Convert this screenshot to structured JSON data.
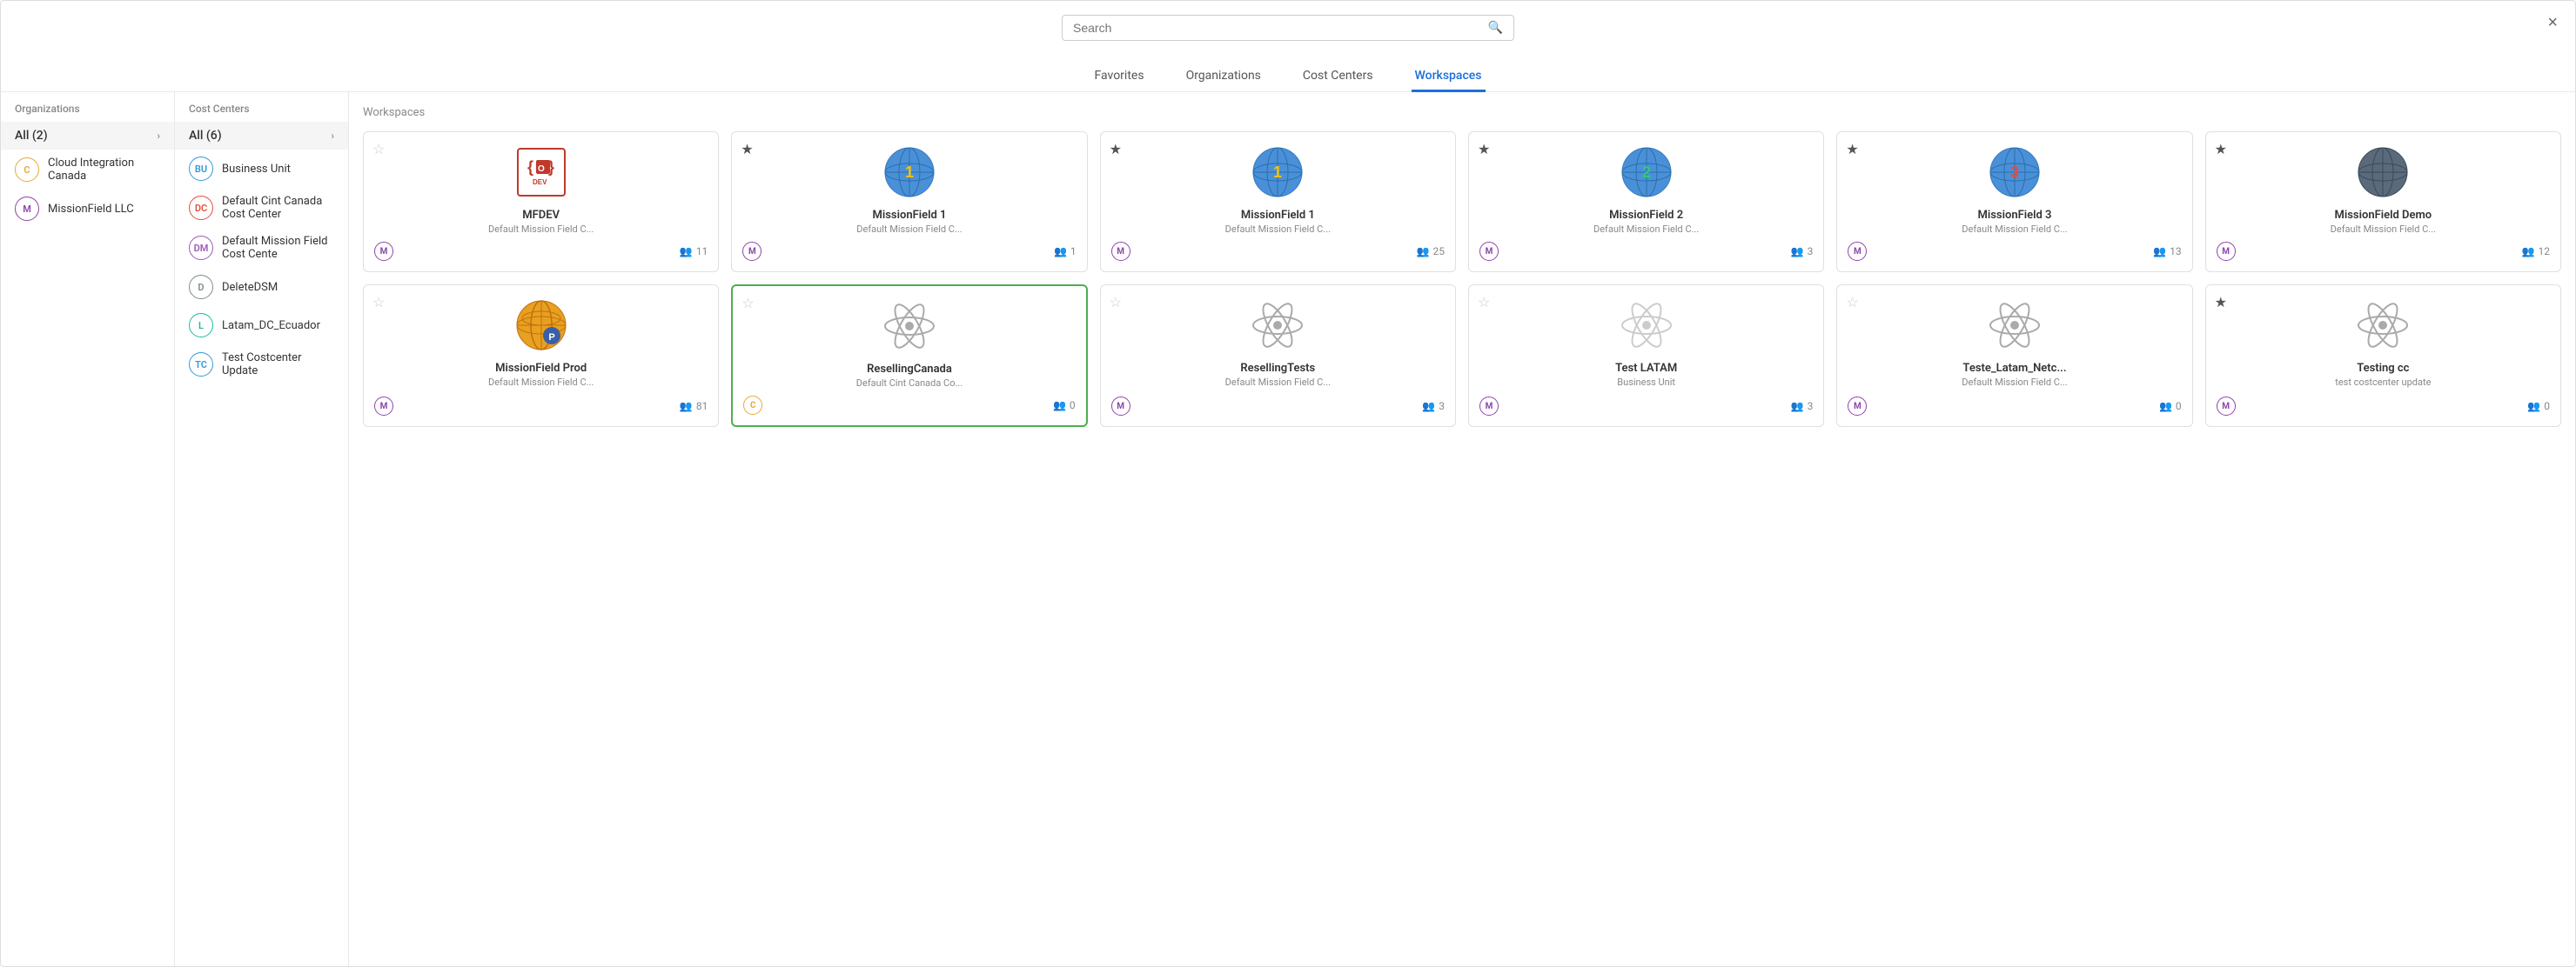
{
  "header": {
    "search_placeholder": "Search",
    "close_label": "×",
    "tabs": [
      {
        "id": "favorites",
        "label": "Favorites",
        "active": false
      },
      {
        "id": "organizations",
        "label": "Organizations",
        "active": false
      },
      {
        "id": "cost-centers",
        "label": "Cost Centers",
        "active": false
      },
      {
        "id": "workspaces",
        "label": "Workspaces",
        "active": true
      }
    ]
  },
  "sidebar": {
    "organizations": {
      "title": "Organizations",
      "all_label": "All (2)",
      "items": [
        {
          "id": "cloud-integration",
          "letter": "C",
          "name": "Cloud Integration Canada",
          "color": "#e8a838"
        },
        {
          "id": "missionfield",
          "letter": "M",
          "name": "MissionField LLC",
          "color": "#8e44ad"
        }
      ]
    },
    "cost_centers": {
      "title": "Cost Centers",
      "all_label": "All (6)",
      "items": [
        {
          "id": "business-unit",
          "letters": "BU",
          "name": "Business Unit",
          "color": "#3498db"
        },
        {
          "id": "default-cint",
          "letters": "DC",
          "name": "Default Cint Canada Cost Center",
          "color": "#e74c3c"
        },
        {
          "id": "default-mission",
          "letters": "DM",
          "name": "Default Mission Field Cost Cente",
          "color": "#9b59b6"
        },
        {
          "id": "delete-dsm",
          "letters": "D",
          "name": "DeleteDSM",
          "color": "#7f8c8d"
        },
        {
          "id": "latam-dc",
          "letters": "L",
          "name": "Latam_DC_Ecuador",
          "color": "#1abc9c"
        },
        {
          "id": "test-costcenter",
          "letters": "TC",
          "name": "Test Costcenter Update",
          "color": "#3498db"
        }
      ]
    }
  },
  "main": {
    "title": "Workspaces",
    "rows": [
      [
        {
          "id": "mfdev",
          "name": "MFDEV",
          "subtitle": "Default Mission Field C...",
          "type": "office",
          "star": false,
          "org_letter": "M",
          "org_color": "#8e44ad",
          "users": 11,
          "selected": false
        },
        {
          "id": "missionfield1-a",
          "name": "MissionField 1",
          "subtitle": "Default Mission Field C...",
          "type": "globe1",
          "star": true,
          "org_letter": "M",
          "org_color": "#8e44ad",
          "users": 1,
          "selected": false
        },
        {
          "id": "missionfield1-b",
          "name": "MissionField 1",
          "subtitle": "Default Mission Field C...",
          "type": "globe1",
          "star": true,
          "org_letter": "M",
          "org_color": "#8e44ad",
          "users": 25,
          "selected": false
        },
        {
          "id": "missionfield2",
          "name": "MissionField 2",
          "subtitle": "Default Mission Field C...",
          "type": "globe2",
          "star": true,
          "org_letter": "M",
          "org_color": "#8e44ad",
          "users": 3,
          "selected": false
        },
        {
          "id": "missionfield3",
          "name": "MissionField 3",
          "subtitle": "Default Mission Field C...",
          "type": "globe3",
          "star": true,
          "org_letter": "M",
          "org_color": "#8e44ad",
          "users": 13,
          "selected": false
        },
        {
          "id": "missionfield-demo",
          "name": "MissionField Demo",
          "subtitle": "Default Mission Field C...",
          "type": "globe-dark",
          "star": true,
          "org_letter": "M",
          "org_color": "#8e44ad",
          "users": 12,
          "selected": false
        }
      ],
      [
        {
          "id": "missionfield-prod",
          "name": "MissionField Prod",
          "subtitle": "Default Mission Field C...",
          "type": "globe-orange",
          "star": false,
          "org_letter": "M",
          "org_color": "#8e44ad",
          "users": 81,
          "selected": false
        },
        {
          "id": "reselling-canada",
          "name": "ResellingCanada",
          "subtitle": "Default Cint Canada Co...",
          "type": "atom-gray",
          "star": false,
          "org_letter": "C",
          "org_color": "#e8a838",
          "users": 0,
          "selected": true
        },
        {
          "id": "reselling-tests",
          "name": "ResellingTests",
          "subtitle": "Default Mission Field C...",
          "type": "atom-gray",
          "star": false,
          "org_letter": "M",
          "org_color": "#8e44ad",
          "users": 3,
          "selected": false
        },
        {
          "id": "test-latam",
          "name": "Test LATAM",
          "subtitle": "Business Unit",
          "type": "atom-light",
          "star": false,
          "org_letter": "M",
          "org_color": "#8e44ad",
          "users": 3,
          "selected": false
        },
        {
          "id": "teste-latam-netc",
          "name": "Teste_Latam_Netc...",
          "subtitle": "Default Mission Field C...",
          "type": "atom-gray",
          "star": false,
          "org_letter": "M",
          "org_color": "#8e44ad",
          "users": 0,
          "selected": false
        },
        {
          "id": "testing-cc",
          "name": "Testing cc",
          "subtitle": "test costcenter update",
          "type": "atom-gray",
          "star": true,
          "org_letter": "M",
          "org_color": "#8e44ad",
          "users": 0,
          "selected": false
        }
      ]
    ]
  },
  "icons": {
    "search": "🔍",
    "users": "👥",
    "star_filled": "★",
    "star_empty": "☆",
    "chevron_right": "›"
  }
}
